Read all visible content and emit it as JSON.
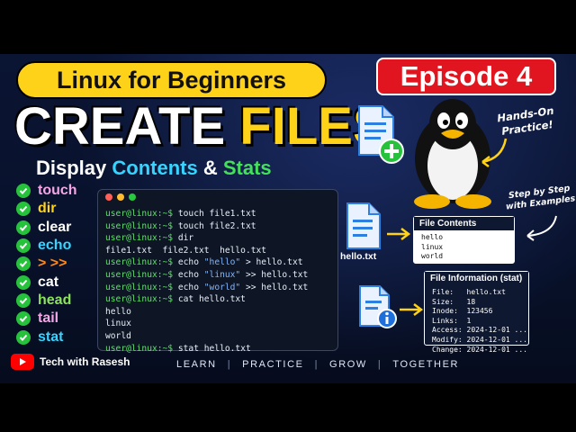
{
  "series_title": "Linux for Beginners",
  "episode": "Episode 4",
  "title": {
    "part1": "CREATE",
    "part2": "FILES"
  },
  "subtitle": {
    "w1": "Display",
    "w2": "Contents",
    "w3": "&",
    "w4": "Stats"
  },
  "commands": [
    {
      "label": "touch",
      "color": "#f4a7e6"
    },
    {
      "label": "dir",
      "color": "#ffd21a"
    },
    {
      "label": "clear",
      "color": "#ffffff"
    },
    {
      "label": "echo",
      "color": "#36d4ff"
    },
    {
      "label": "> >>",
      "color": "#ff8a1c"
    },
    {
      "label": "cat",
      "color": "#ffffff"
    },
    {
      "label": "head",
      "color": "#8be45a"
    },
    {
      "label": "tail",
      "color": "#f4a7e6"
    },
    {
      "label": "stat",
      "color": "#36d4ff"
    }
  ],
  "terminal": {
    "prompt": "user@linux:~$",
    "lines": [
      {
        "type": "cmd",
        "cmd": "touch file1.txt"
      },
      {
        "type": "cmd",
        "cmd": "touch file2.txt"
      },
      {
        "type": "cmd",
        "cmd": "dir"
      },
      {
        "type": "out",
        "text": "file1.txt  file2.txt  hello.txt"
      },
      {
        "type": "echo",
        "pre": "echo ",
        "str": "\"hello\"",
        "post": " > hello.txt"
      },
      {
        "type": "echo",
        "pre": "echo ",
        "str": "\"linux\"",
        "post": " >> hello.txt"
      },
      {
        "type": "echo",
        "pre": "echo ",
        "str": "\"world\"",
        "post": " >> hello.txt"
      },
      {
        "type": "cmd",
        "cmd": "cat hello.txt"
      },
      {
        "type": "out",
        "text": "hello"
      },
      {
        "type": "out",
        "text": "linux"
      },
      {
        "type": "out",
        "text": "world"
      },
      {
        "type": "cmd",
        "cmd": "stat hello.txt"
      }
    ]
  },
  "hands_on": "Hands-On Practice!",
  "step_by_step": "Step by Step with Examples",
  "file_label": "hello.txt",
  "file_contents": {
    "title": "File Contents",
    "lines": [
      "hello",
      "linux",
      "world"
    ]
  },
  "file_info": {
    "title": "File Information (stat)",
    "lines": [
      "File:   hello.txt",
      "Size:   18",
      "Inode:  123456",
      "Links:  1",
      "Access: 2024-12-01 ...",
      "Modify: 2024-12-01 ...",
      "Change: 2024-12-01 ..."
    ]
  },
  "channel": "Tech with Rasesh",
  "motto": [
    "LEARN",
    "PRACTICE",
    "GROW",
    "TOGETHER"
  ]
}
